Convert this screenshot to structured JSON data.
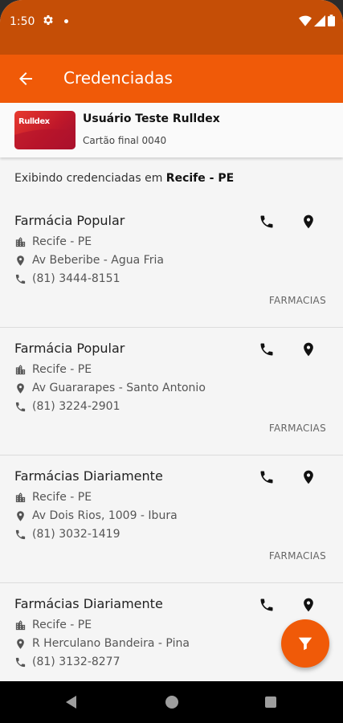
{
  "status_bar": {
    "time": "1:50"
  },
  "app_bar": {
    "title": "Credenciadas"
  },
  "card": {
    "logo_text": "Rulldex",
    "user_name": "Usuário Teste Rulldex",
    "subtitle": "Cartão final 0040"
  },
  "location": {
    "prefix": "Exibindo credenciadas em",
    "place": "Recife - PE"
  },
  "items": [
    {
      "name": "Farmácia Popular",
      "city": "Recife - PE",
      "address": "Av Beberibe - Agua Fria",
      "phone": "(81) 3444-8151",
      "category": "FARMACIAS"
    },
    {
      "name": "Farmácia Popular",
      "city": "Recife - PE",
      "address": "Av Guararapes - Santo Antonio",
      "phone": "(81) 3224-2901",
      "category": "FARMACIAS"
    },
    {
      "name": "Farmácias Diariamente",
      "city": "Recife - PE",
      "address": "Av Dois Rios, 1009 - Ibura",
      "phone": "(81) 3032-1419",
      "category": "FARMACIAS"
    },
    {
      "name": "Farmácias Diariamente",
      "city": "Recife - PE",
      "address": "R Herculano Bandeira - Pina",
      "phone": "(81) 3132-8277",
      "category": ""
    }
  ],
  "colors": {
    "primary": "#f05a08",
    "status_bar": "#c54e06"
  }
}
